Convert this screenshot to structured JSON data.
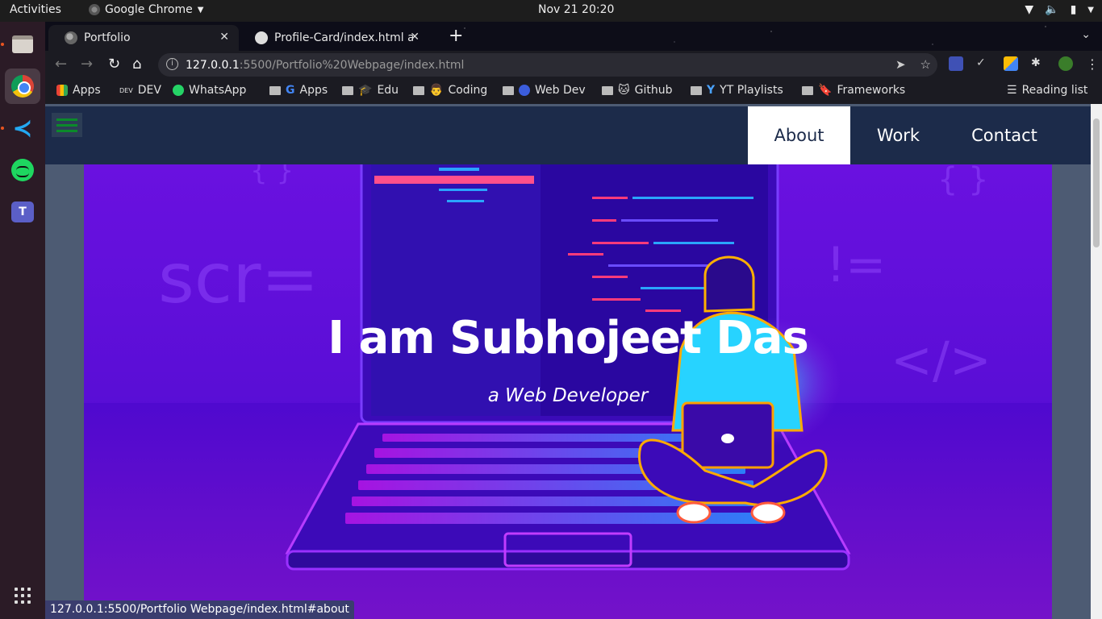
{
  "system_bar": {
    "activities": "Activities",
    "app_name": "Google Chrome",
    "clock": "Nov 21  20:20"
  },
  "dock": {
    "apps": [
      "files",
      "chrome",
      "vscode",
      "spotify",
      "teams",
      "show-apps"
    ]
  },
  "tabs": [
    {
      "title": "Portfolio",
      "active": true
    },
    {
      "title": "Profile-Card/index.html a",
      "active": false
    }
  ],
  "address_bar": {
    "host": "127.0.0.1",
    "path": ":5500/Portfolio%20Webpage/index.html"
  },
  "bookmarks": [
    {
      "label": "Apps",
      "icon": "apps-grid-icon"
    },
    {
      "label": "DEV",
      "icon": "dev-icon"
    },
    {
      "label": "WhatsApp",
      "icon": "whatsapp-icon"
    },
    {
      "label": "Apps",
      "icon": "google-icon"
    },
    {
      "label": "Edu",
      "icon": "folder-icon"
    },
    {
      "label": "Coding",
      "icon": "folder-icon"
    },
    {
      "label": "Web Dev",
      "icon": "folder-icon"
    },
    {
      "label": "Github",
      "icon": "folder-icon"
    },
    {
      "label": "YT Playlists",
      "icon": "folder-icon"
    },
    {
      "label": "Frameworks",
      "icon": "folder-icon"
    }
  ],
  "reading_list": "Reading list",
  "site": {
    "nav": [
      {
        "label": "About",
        "active": true
      },
      {
        "label": "Work",
        "active": false
      },
      {
        "label": "Contact",
        "active": false
      }
    ],
    "hero_title": "I am Subhojeet Das",
    "hero_subtitle": "a Web Developer",
    "deco_texts": [
      "scr=",
      "</>",
      "!=",
      "{ }",
      "{ }"
    ]
  },
  "status_url": "127.0.0.1:5500/Portfolio Webpage/index.html#about",
  "colors": {
    "nav_bg": "#1c2b4a",
    "hero_purple": "#6a11e0",
    "page_bg": "#4d5b73"
  }
}
